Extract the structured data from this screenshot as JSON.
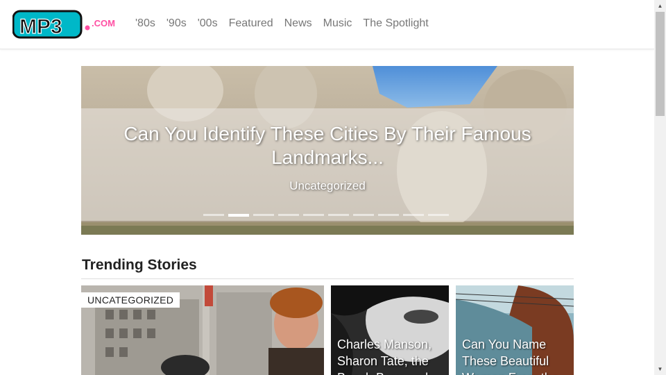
{
  "brand": {
    "logo_text": "MP3",
    "logo_suffix": ".COM"
  },
  "nav": {
    "items": [
      {
        "label": "'80s"
      },
      {
        "label": "'90s"
      },
      {
        "label": "'00s"
      },
      {
        "label": "Featured"
      },
      {
        "label": "News"
      },
      {
        "label": "Music"
      },
      {
        "label": "The Spotlight"
      }
    ]
  },
  "hero": {
    "title": "Can You Identify These Cities By Their Famous Landmarks...",
    "category": "Uncategorized",
    "slide_count": 10,
    "active_slide": 2
  },
  "trending": {
    "heading": "Trending Stories",
    "cards": [
      {
        "badge": "UNCATEGORIZED"
      },
      {
        "title": "Charles Manson, Sharon Tate, the Beach Boys and..."
      },
      {
        "title": "Can You Name These Beautiful Women From the..."
      }
    ]
  },
  "colors": {
    "accent_pink": "#ff4fa3",
    "logo_teal": "#00b8c8",
    "nav_text": "#777777"
  },
  "icons": {
    "scroll_up": "triangle-up-icon",
    "scroll_down": "triangle-down-icon"
  }
}
